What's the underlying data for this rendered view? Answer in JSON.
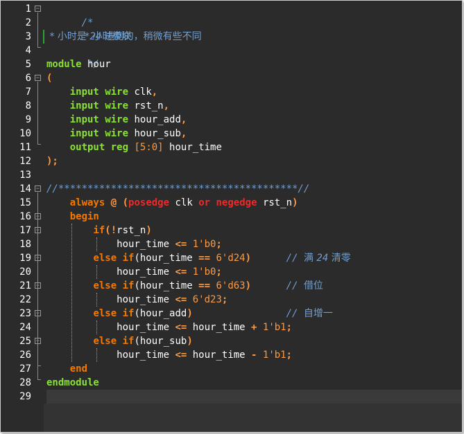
{
  "editor": {
    "line_numbers": [
      "1",
      "2",
      "3",
      "4",
      "5",
      "6",
      "7",
      "8",
      "9",
      "10",
      "11",
      "12",
      "13",
      "14",
      "15",
      "16",
      "17",
      "18",
      "19",
      "20",
      "21",
      "22",
      "23",
      "24",
      "25",
      "26",
      "27",
      "28",
      "29"
    ],
    "tokens": {
      "comment_open": "/*",
      "l2": " * 小时模块",
      "l3a": " * 小时是 ",
      "l3b": "24",
      "l3c": " 进制的，稍微有些不同",
      "comment_close": " */",
      "module": "module",
      "hour": " hour",
      "lparen": "(",
      "input": "input",
      "wire": "wire",
      "clk": " clk",
      "rst_n": " rst_n",
      "hour_add": " hour_add",
      "hour_sub": " hour_sub",
      "comma": ",",
      "output": "output",
      "reg": "reg",
      "range": "[5:0]",
      "hour_time": " hour_time",
      "close_paren_semi": ");",
      "stars_comment": "//*****************************************//",
      "always": "always",
      "at": "@",
      "open_p": " (",
      "posedge": "posedge",
      "clk_kw": " clk ",
      "or": "or",
      "negedge": "negedge",
      "rst_tail": " rst_n",
      "close_p": ")",
      "begin": "begin",
      "if": "if",
      "not_rst": "(!",
      "rst_ident": "rst_n",
      "ht": "hour_time",
      "le": " <= ",
      "b0": "1'b0",
      "semi": ";",
      "else_if": "else if",
      "paren_ht": "(hour_time",
      "eqeq": " == ",
      "d24": "6'd24",
      "d63": "6'd63",
      "d23": "6'd23",
      "rp": ")",
      "cmt_slash": "// ",
      "c19a": "满 ",
      "c19b": "24",
      "c19c": " 清零",
      "c21": "借位",
      "c23": "自增一",
      "paren_add": "(hour_add",
      "paren_sub": "(hour_sub",
      "plus": " + ",
      "minus": " - ",
      "b1": "1'b1",
      "end": "end",
      "endmodule": "endmodule"
    }
  }
}
